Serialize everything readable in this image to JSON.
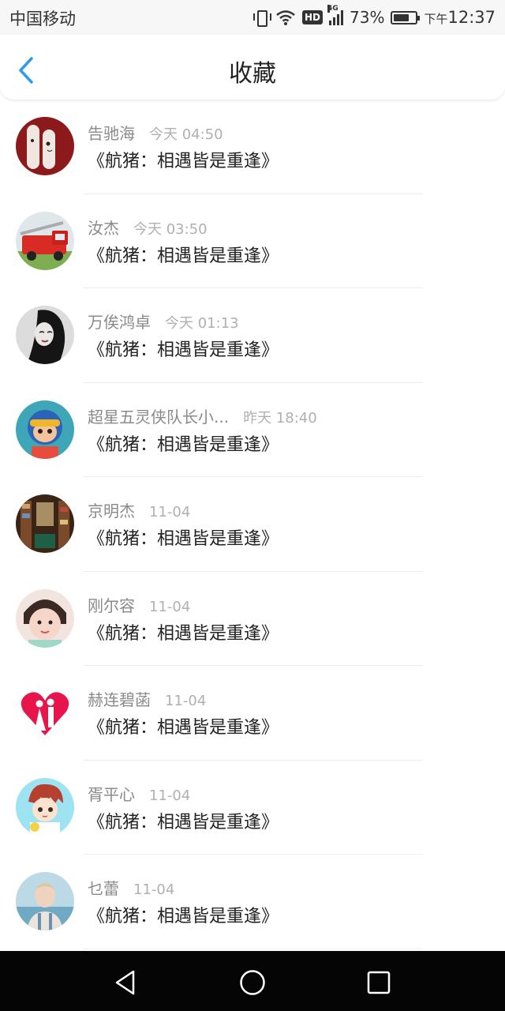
{
  "status_bar": {
    "carrier": "中国移动",
    "hd_label": "HD",
    "network_label": "4G",
    "battery_percent": "73%",
    "battery_level": 0.73,
    "clock_ampm": "下午",
    "clock_time": "12:37"
  },
  "nav": {
    "back_icon": "chevron-left-icon",
    "title": "收藏",
    "accent_color": "#2d9cf0"
  },
  "items": [
    {
      "name": "告驰海",
      "time": "今天 04:50",
      "content": "《航猪：相遇皆是重逢》",
      "avatar_icon": "avatar-dark-red-photo"
    },
    {
      "name": "汝杰",
      "time": "今天 03:50",
      "content": "《航猪：相遇皆是重逢》",
      "avatar_icon": "avatar-fire-truck-photo"
    },
    {
      "name": "万俟鸿卓",
      "time": "今天 01:13",
      "content": "《航猪：相遇皆是重逢》",
      "avatar_icon": "avatar-woman-bw-photo"
    },
    {
      "name": "超星五灵侠队长小...",
      "time": "昨天 18:40",
      "content": "《航猪：相遇皆是重逢》",
      "avatar_icon": "avatar-cartoon-hero-photo"
    },
    {
      "name": "京明杰",
      "time": "11-04",
      "content": "《航猪：相遇皆是重逢》",
      "avatar_icon": "avatar-bookstore-photo"
    },
    {
      "name": "刚尔容",
      "time": "11-04",
      "content": "《航猪：相遇皆是重逢》",
      "avatar_icon": "avatar-child-photo"
    },
    {
      "name": "赫连碧菡",
      "time": "11-04",
      "content": "《航猪：相遇皆是重逢》",
      "avatar_icon": "avatar-heart-couple-icon"
    },
    {
      "name": "胥平心",
      "time": "11-04",
      "content": "《航猪：相遇皆是重逢》",
      "avatar_icon": "avatar-anime-boy-photo"
    },
    {
      "name": "乜蕾",
      "time": "11-04",
      "content": "《航猪：相遇皆是重逢》",
      "avatar_icon": "avatar-man-beach-photo"
    }
  ],
  "soft_keys": {
    "back_icon": "triangle-back-icon",
    "home_icon": "circle-home-icon",
    "recents_icon": "square-recents-icon"
  }
}
